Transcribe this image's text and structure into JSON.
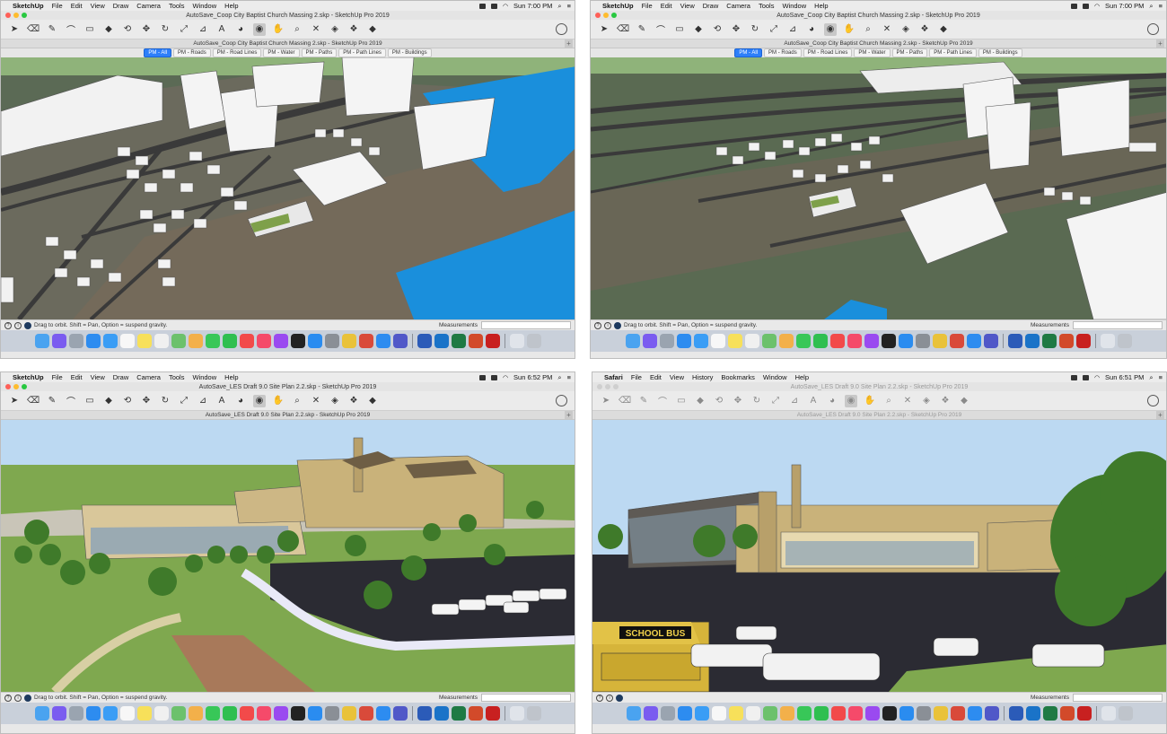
{
  "panels": [
    {
      "menubar": {
        "app": "SketchUp",
        "items": [
          "File",
          "Edit",
          "View",
          "Draw",
          "Camera",
          "Tools",
          "Window",
          "Help"
        ],
        "clock": "Sun 7:00 PM"
      },
      "window_title": "AutoSave_Coop City Baptist Church Massing 2.skp - SketchUp Pro 2019",
      "doc_title": "AutoSave_Coop City Baptist Church Massing 2.skp - SketchUp Pro 2019",
      "scene_tabs": [
        "PM - All",
        "PM - Roads",
        "PM - Road Lines",
        "PM - Water",
        "PM - Paths",
        "PM - Path Lines",
        "PM - Buildings"
      ],
      "active_tab": 0,
      "status": "Drag to orbit. Shift = Pan, Option = suspend gravity.",
      "measurements_label": "Measurements"
    },
    {
      "menubar": {
        "app": "SketchUp",
        "items": [
          "File",
          "Edit",
          "View",
          "Draw",
          "Camera",
          "Tools",
          "Window",
          "Help"
        ],
        "clock": "Sun 7:00 PM"
      },
      "window_title": "AutoSave_Coop City Baptist Church Massing 2.skp - SketchUp Pro 2019",
      "doc_title": "AutoSave_Coop City Baptist Church Massing 2.skp - SketchUp Pro 2019",
      "scene_tabs": [
        "PM - All",
        "PM - Roads",
        "PM - Road Lines",
        "PM - Water",
        "PM - Paths",
        "PM - Path Lines",
        "PM - Buildings"
      ],
      "active_tab": 0,
      "status": "Drag to orbit. Shift = Pan, Option = suspend gravity.",
      "measurements_label": "Measurements"
    },
    {
      "menubar": {
        "app": "SketchUp",
        "items": [
          "File",
          "Edit",
          "View",
          "Draw",
          "Camera",
          "Tools",
          "Window",
          "Help"
        ],
        "clock": "Sun 6:52 PM"
      },
      "window_title": "AutoSave_LES Draft 9.0 Site Plan 2.2.skp - SketchUp Pro 2019",
      "doc_title": "AutoSave_LES Draft 9.0 Site Plan 2.2.skp - SketchUp Pro 2019",
      "status": "Drag to orbit. Shift = Pan, Option = suspend gravity.",
      "measurements_label": "Measurements"
    },
    {
      "menubar": {
        "app": "Safari",
        "items": [
          "File",
          "Edit",
          "View",
          "History",
          "Bookmarks",
          "Window",
          "Help"
        ],
        "clock": "Sun 6:51 PM"
      },
      "window_title": "AutoSave_LES Draft 9.0 Site Plan 2.2.skp - SketchUp Pro 2019",
      "doc_title": "AutoSave_LES Draft 9.0 Site Plan 2.2.skp - SketchUp Pro 2019",
      "bus_label": "SCHOOL BUS",
      "measurements_label": "Measurements"
    }
  ],
  "colors": {
    "sky": "#bcd9f2",
    "water": "#1a8fdc",
    "grass": "#7fa84f",
    "road": "#3a3a3a",
    "asphalt": "#2b2b33",
    "building": "#f4f4f4",
    "brick": "#c9b27a",
    "tab_active": "#2d7ff9"
  },
  "dock_icons": [
    "finder-icon",
    "siri-icon",
    "launchpad-icon",
    "safari-icon",
    "mail-icon",
    "calendar-icon",
    "notes-icon",
    "reminders-icon",
    "maps-icon",
    "photos-icon",
    "messages-icon",
    "facetime-icon",
    "news-icon",
    "music-icon",
    "podcasts-icon",
    "tv-icon",
    "appstore-icon",
    "preferences-icon",
    "chrome-icon",
    "sketchup-icon",
    "zoom-icon",
    "teams-icon",
    "word-icon",
    "outlook-icon",
    "excel-icon",
    "powerpoint-icon",
    "acrobat-icon",
    "preview-icon",
    "trash-icon"
  ]
}
